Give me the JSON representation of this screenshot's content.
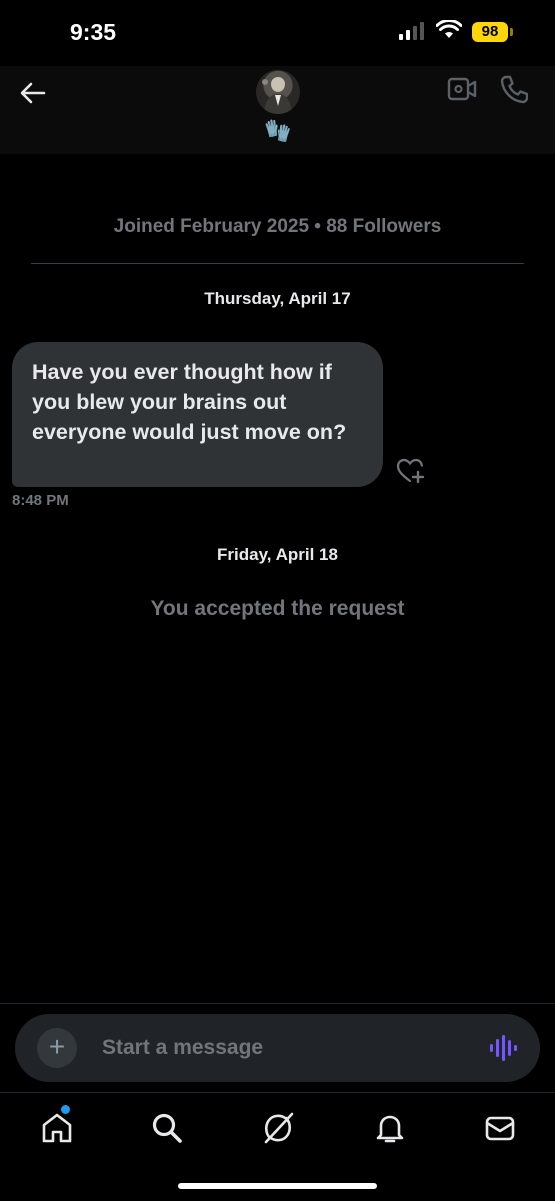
{
  "status_bar": {
    "time": "9:35",
    "battery": "98"
  },
  "header": {
    "avatar_icon": "profile-photo",
    "status_emoji": "🧤"
  },
  "profile_info": "Joined February 2025 • 88 Followers",
  "conversation": {
    "date_1": "Thursday, April 17",
    "message_text": "Have you ever thought how if you blew your brains out everyone would just move on?",
    "message_time": "8:48 PM",
    "date_2": "Friday, April 18",
    "system_note": "You accepted the request"
  },
  "composer": {
    "placeholder": "Start a message",
    "add_label": "+"
  },
  "colors": {
    "background": "#000000",
    "bubble": "#2f3336",
    "muted_text": "#71767b",
    "accent": "#1d9bf0",
    "voice": "#7856ff"
  },
  "tabs": [
    "home-icon",
    "search-icon",
    "grok-icon",
    "notifications-icon",
    "messages-icon"
  ]
}
